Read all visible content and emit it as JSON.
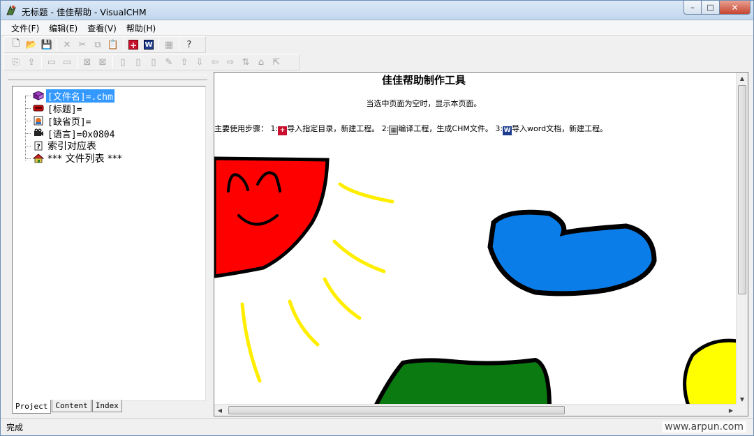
{
  "window": {
    "title": "无标题 - 佳佳帮助 - VisualCHM",
    "controls": {
      "minimize": "–",
      "maximize": "□",
      "close": "✕"
    }
  },
  "menu": [
    "文件(F)",
    "编辑(E)",
    "查看(V)",
    "帮助(H)"
  ],
  "toolbar1": [
    {
      "name": "new-file",
      "glyph": "🗋",
      "enabled": true
    },
    {
      "name": "open-folder",
      "glyph": "📂",
      "enabled": true
    },
    {
      "name": "save",
      "glyph": "💾",
      "enabled": true
    },
    {
      "sep": true
    },
    {
      "name": "delete",
      "glyph": "✕",
      "enabled": false
    },
    {
      "name": "cut",
      "glyph": "✂",
      "enabled": false
    },
    {
      "name": "copy",
      "glyph": "⧉",
      "enabled": false
    },
    {
      "name": "paste",
      "glyph": "📋",
      "enabled": false
    },
    {
      "sep": true
    },
    {
      "name": "import-directory",
      "glyph": "+",
      "enabled": true,
      "style": "plus"
    },
    {
      "name": "import-word",
      "glyph": "W",
      "enabled": true,
      "style": "word"
    },
    {
      "sep": true
    },
    {
      "name": "compile",
      "glyph": "▦",
      "enabled": false
    },
    {
      "sep": true
    },
    {
      "name": "help",
      "glyph": "?",
      "enabled": true
    }
  ],
  "toolbar2": [
    {
      "name": "tb2-a",
      "glyph": "⎘",
      "enabled": false
    },
    {
      "name": "tb2-b",
      "glyph": "⇪",
      "enabled": false
    },
    {
      "sep": true
    },
    {
      "name": "tb2-folder",
      "glyph": "▭",
      "enabled": false
    },
    {
      "name": "tb2-folder-add",
      "glyph": "▭",
      "enabled": false
    },
    {
      "sep": true
    },
    {
      "name": "tb2-c",
      "glyph": "⊠",
      "enabled": false
    },
    {
      "name": "tb2-d",
      "glyph": "⊠",
      "enabled": false
    },
    {
      "sep": true
    },
    {
      "name": "tb2-page",
      "glyph": "▯",
      "enabled": false
    },
    {
      "name": "tb2-page-add",
      "glyph": "▯",
      "enabled": false
    },
    {
      "name": "tb2-page-edit",
      "glyph": "▯",
      "enabled": false
    },
    {
      "name": "tb2-brush",
      "glyph": "✎",
      "enabled": false
    },
    {
      "name": "tb2-up",
      "glyph": "⇧",
      "enabled": false
    },
    {
      "name": "tb2-down",
      "glyph": "⇩",
      "enabled": false
    },
    {
      "name": "tb2-left",
      "glyph": "⇦",
      "enabled": false
    },
    {
      "name": "tb2-right",
      "glyph": "⇨",
      "enabled": false
    },
    {
      "name": "tb2-sort",
      "glyph": "⇅",
      "enabled": false
    },
    {
      "name": "tb2-e",
      "glyph": "⌂",
      "enabled": false
    },
    {
      "name": "tb2-f",
      "glyph": "⇱",
      "enabled": false
    }
  ],
  "tree": {
    "items": [
      {
        "label": "[文件名]=.chm",
        "icon": "book-icon",
        "selected": true
      },
      {
        "label": "[标题]=",
        "icon": "title-icon",
        "selected": false
      },
      {
        "label": "[缺省页]=",
        "icon": "default-page-icon",
        "selected": false
      },
      {
        "label": "[语言]=0x0804",
        "icon": "language-icon",
        "selected": false
      },
      {
        "label": "索引对应表",
        "icon": "question-icon",
        "selected": false
      },
      {
        "label": "*** 文件列表 ***",
        "icon": "house-icon",
        "selected": false
      }
    ]
  },
  "tabs": [
    "Project",
    "Content",
    "Index"
  ],
  "content": {
    "title": "佳佳帮助制作工具",
    "subtitle": "当选中页面为空时，显示本页面。",
    "steps_prefix": "主要使用步骤： 1:",
    "step1": "导入指定目录，新建工程。 2:",
    "step2": "编译工程，生成CHM文件。 3:",
    "step3": "导入word文档，新建工程。"
  },
  "status": {
    "text": "完成",
    "watermark": "www.arpun.com"
  },
  "colors": {
    "sun": "#ff0000",
    "cloud": "#0a7de8",
    "hill": "#0b7a10",
    "sun2": "#ffff00",
    "rays": "#ffff00",
    "selection": "#3399ff"
  }
}
